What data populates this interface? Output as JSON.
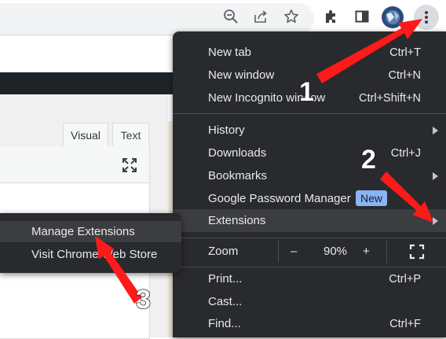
{
  "toolbar": {
    "icons": [
      "zoom-out-icon",
      "share-icon",
      "star-icon",
      "extensions-icon",
      "side-panel-icon",
      "avatar",
      "more-icon"
    ]
  },
  "editor": {
    "tabs": [
      "Visual",
      "Text"
    ]
  },
  "menu": {
    "items": [
      {
        "label": "New tab",
        "shortcut": "Ctrl+T"
      },
      {
        "label": "New window",
        "shortcut": "Ctrl+N"
      },
      {
        "label": "New Incognito window",
        "shortcut": "Ctrl+Shift+N"
      },
      {
        "label": "History",
        "shortcut": ""
      },
      {
        "label": "Downloads",
        "shortcut": "Ctrl+J"
      },
      {
        "label": "Bookmarks",
        "shortcut": ""
      },
      {
        "label": "Google Password Manager",
        "badge": "New"
      },
      {
        "label": "Extensions",
        "shortcut": ""
      },
      {
        "label": "Print...",
        "shortcut": "Ctrl+P"
      },
      {
        "label": "Cast...",
        "shortcut": ""
      },
      {
        "label": "Find...",
        "shortcut": "Ctrl+F"
      }
    ],
    "zoom": {
      "label": "Zoom",
      "minus": "–",
      "value": "90%",
      "plus": "+"
    }
  },
  "submenu": {
    "items": [
      "Manage Extensions",
      "Visit Chrome Web Store"
    ]
  },
  "annotations": {
    "step1": "1",
    "step2": "2",
    "step3": "3",
    "arrow_color": "#ff1a1a"
  }
}
